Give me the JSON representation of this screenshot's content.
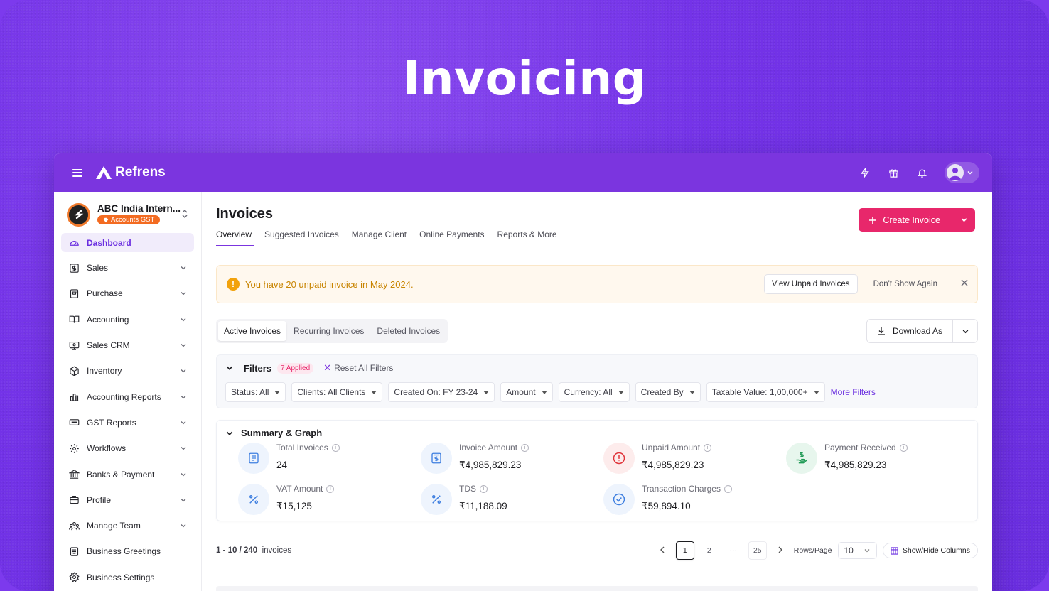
{
  "hero": {
    "title": "Invoicing"
  },
  "topbar": {
    "brand": "Refrens"
  },
  "org": {
    "name": "ABC India Intern...",
    "badge": "Accounts GST"
  },
  "sidebar": {
    "items": [
      {
        "label": "Dashboard",
        "icon": "dashboard-icon"
      },
      {
        "label": "Sales",
        "icon": "dollar-icon"
      },
      {
        "label": "Purchase",
        "icon": "cart-icon"
      },
      {
        "label": "Accounting",
        "icon": "book-icon"
      },
      {
        "label": "Sales CRM",
        "icon": "crm-icon"
      },
      {
        "label": "Inventory",
        "icon": "box-icon"
      },
      {
        "label": "Accounting Reports",
        "icon": "bar-chart-icon"
      },
      {
        "label": "GST Reports",
        "icon": "gst-icon"
      },
      {
        "label": "Workflows",
        "icon": "workflow-gear-icon"
      },
      {
        "label": "Banks & Payment",
        "icon": "bank-icon"
      },
      {
        "label": "Profile",
        "icon": "briefcase-icon"
      },
      {
        "label": "Manage Team",
        "icon": "team-icon"
      },
      {
        "label": "Business Greetings",
        "icon": "greeting-icon"
      },
      {
        "label": "Business Settings",
        "icon": "settings-icon"
      }
    ]
  },
  "page": {
    "title": "Invoices",
    "tabs": [
      "Overview",
      "Suggested Invoices",
      "Manage Client",
      "Online Payments",
      "Reports & More"
    ],
    "create_label": "Create Invoice"
  },
  "alert": {
    "text": "You have 20 unpaid invoice in May 2024.",
    "view_label": "View Unpaid Invoices",
    "dismiss_label": "Don't Show Again"
  },
  "segments": [
    "Active Invoices",
    "Recurring Invoices",
    "Deleted Invoices"
  ],
  "download_label": "Download As",
  "filters": {
    "title": "Filters",
    "applied": "7 Applied",
    "reset": "Reset All Filters",
    "chips": [
      "Status: All",
      "Clients: All Clients",
      "Created On: FY 23-24",
      "Amount",
      "Currency: All",
      "Created By",
      "Taxable Value: 1,00,000+"
    ],
    "more": "More Filters"
  },
  "summary": {
    "title": "Summary & Graph",
    "stats": [
      {
        "label": "Total Invoices",
        "value": "24",
        "icon": "document-list-icon",
        "color": "#3f7fe0",
        "bg": "#eef4fd"
      },
      {
        "label": "Invoice Amount",
        "value": "₹4,985,829.23",
        "icon": "invoice-dollar-icon",
        "color": "#3f7fe0",
        "bg": "#eef4fd"
      },
      {
        "label": "Unpaid Amount",
        "value": "₹4,985,829.23",
        "icon": "alert-circle-icon",
        "color": "#e0343a",
        "bg": "#fdecec"
      },
      {
        "label": "Payment Received",
        "value": "₹4,985,829.23",
        "icon": "money-hand-icon",
        "color": "#1f9a55",
        "bg": "#e7f6ed"
      },
      {
        "label": "VAT Amount",
        "value": "₹15,125",
        "icon": "percent-icon",
        "color": "#3f7fe0",
        "bg": "#eef4fd"
      },
      {
        "label": "TDS",
        "value": "₹11,188.09",
        "icon": "percent-icon",
        "color": "#3f7fe0",
        "bg": "#eef4fd"
      },
      {
        "label": "Transaction Charges",
        "value": "₹59,894.10",
        "icon": "check-circle-icon",
        "color": "#3f7fe0",
        "bg": "#eef4fd"
      }
    ]
  },
  "pager": {
    "range": "1 - 10 / 240",
    "unit": "invoices",
    "pages": [
      "1",
      "2",
      "···",
      "25"
    ],
    "rows_label": "Rows/Page",
    "rows_value": "10",
    "columns_label": "Show/Hide Columns"
  }
}
